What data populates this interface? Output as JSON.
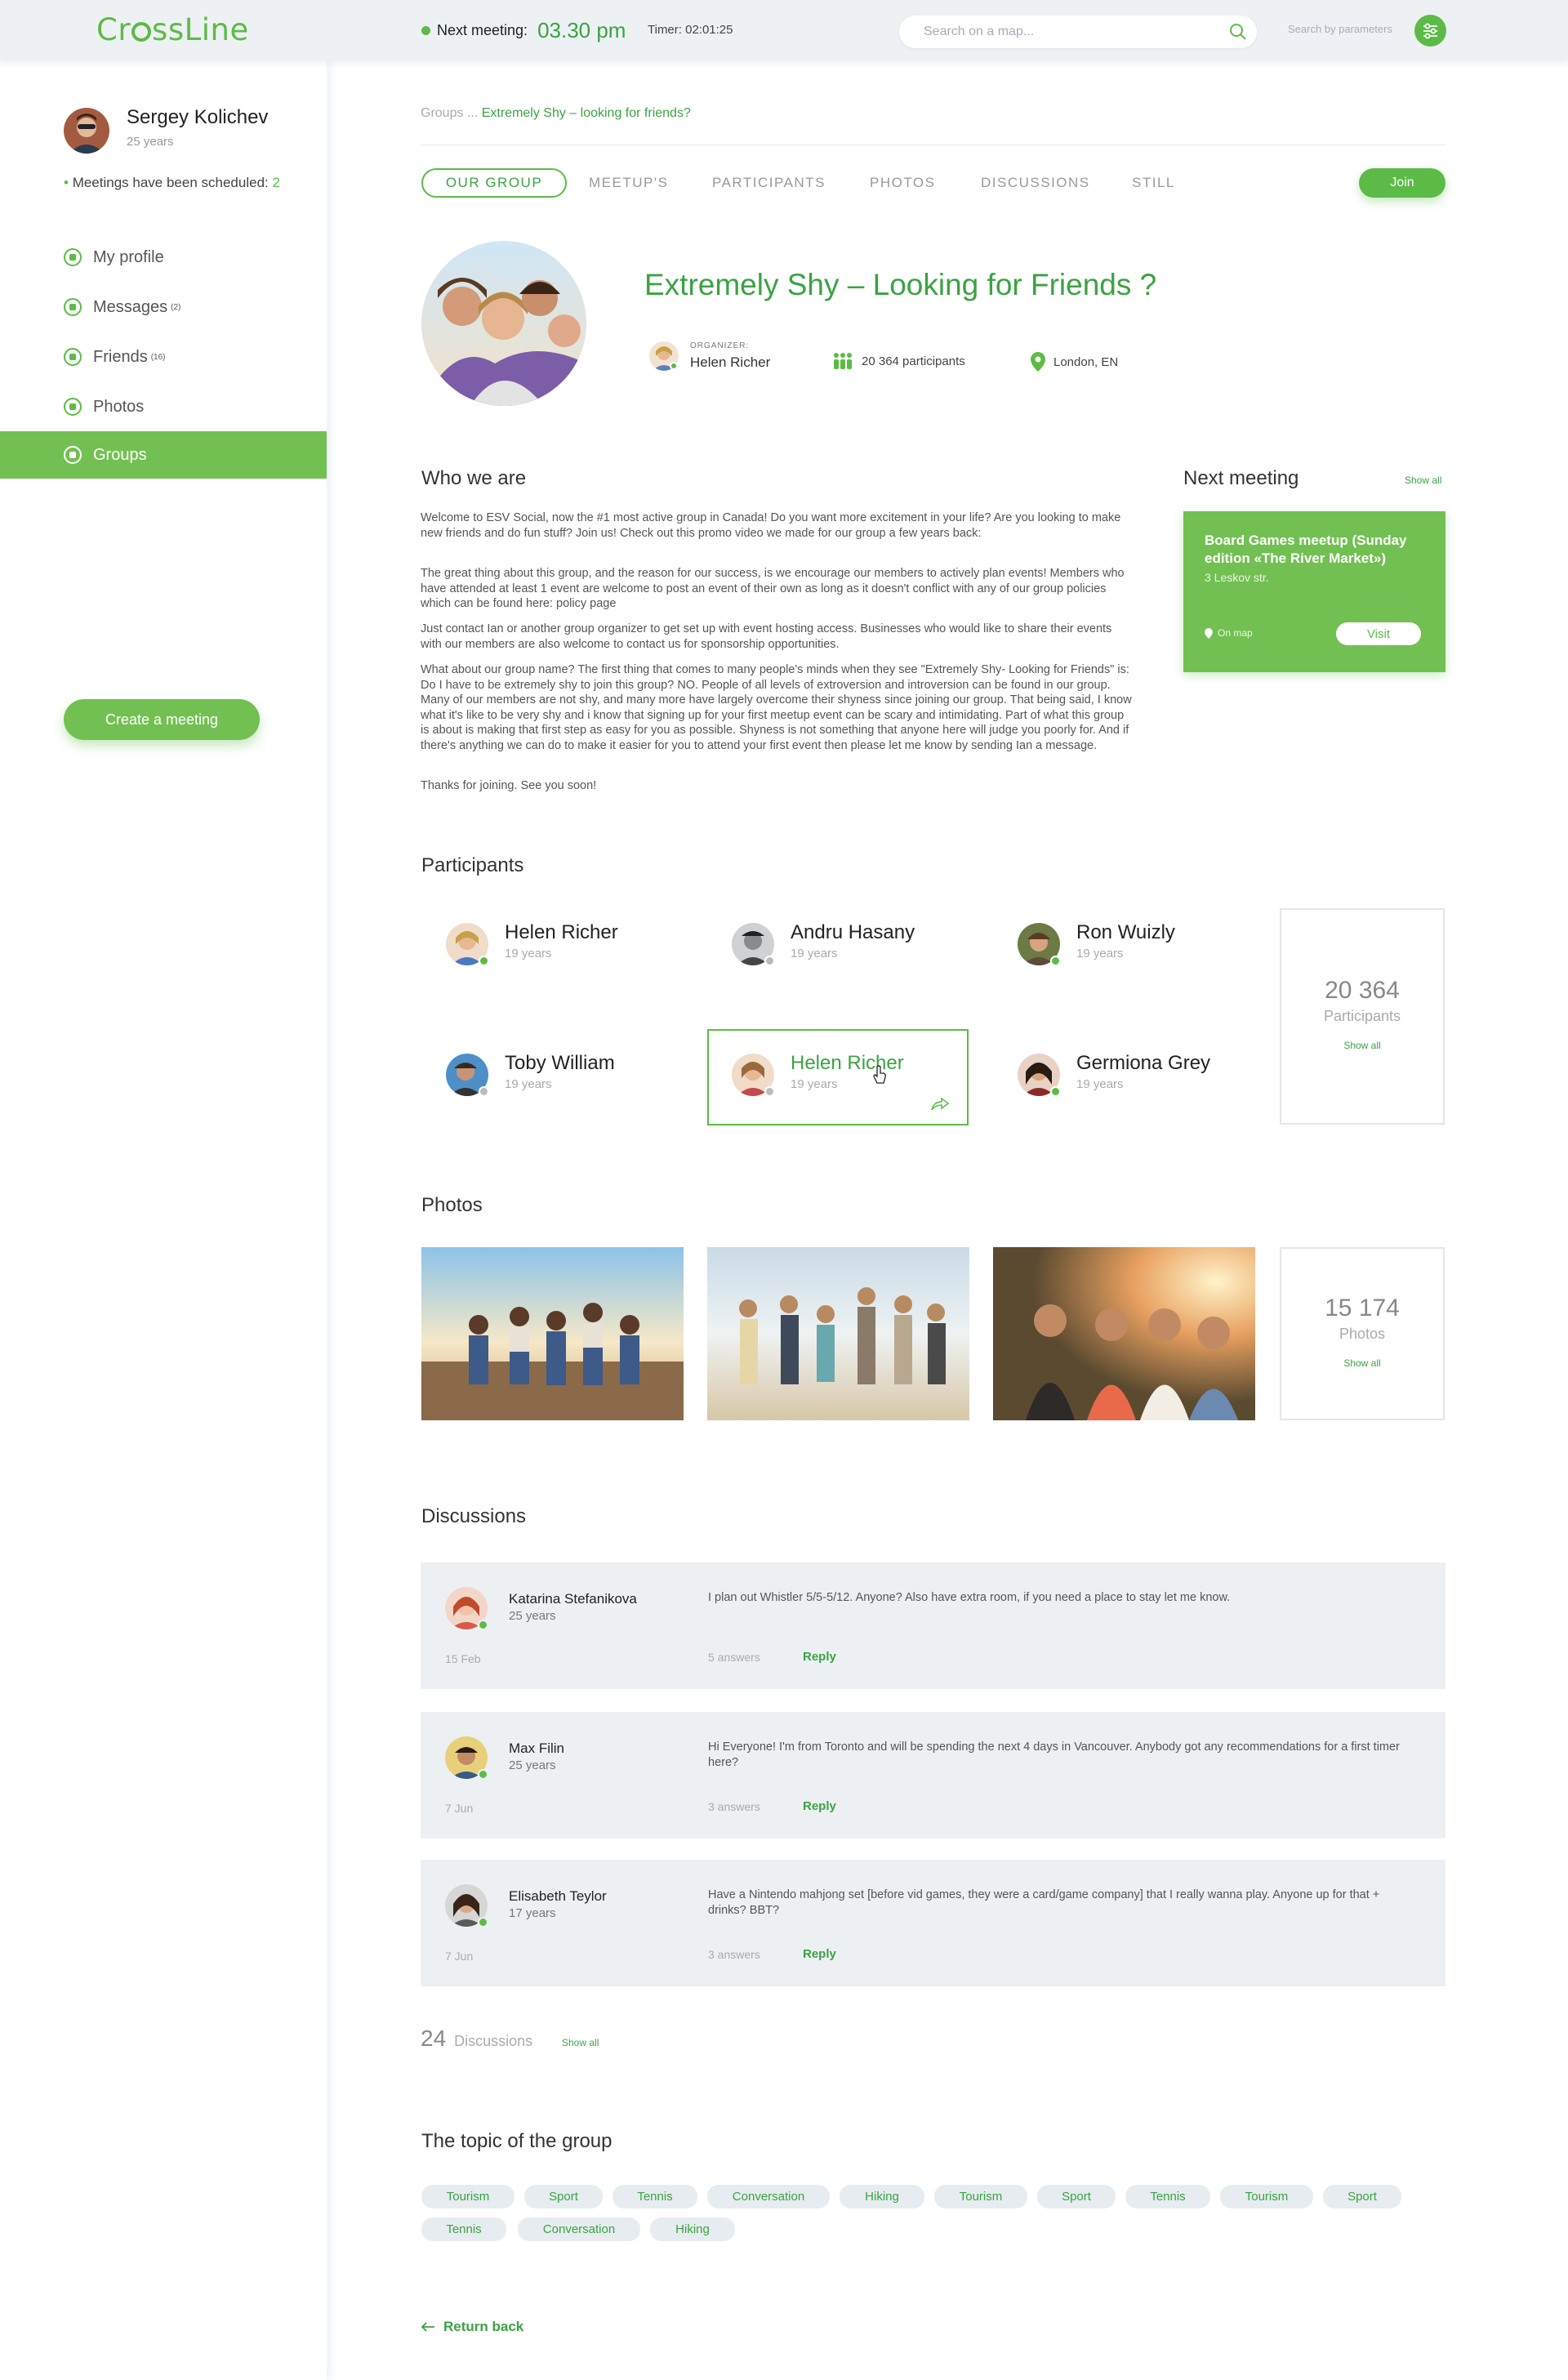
{
  "header": {
    "logo": "CrossLine",
    "next_meeting_label": "Next meeting:",
    "next_meeting_time": "03.30 pm",
    "timer": "Timer: 02:01:25",
    "search_placeholder": "Search on a map...",
    "search_by_params": "Search by parameters"
  },
  "user": {
    "name": "Sergey Kolichev",
    "age": "25 years",
    "meetings_label": "Meetings have been scheduled:",
    "meetings_count": "2"
  },
  "sidebar": {
    "items": [
      {
        "label": "My profile",
        "badge": ""
      },
      {
        "label": "Messages",
        "badge": "(2)"
      },
      {
        "label": "Friends",
        "badge": "(16)"
      },
      {
        "label": "Photos",
        "badge": ""
      },
      {
        "label": "Groups",
        "badge": ""
      }
    ],
    "create_button": "Create a meeting"
  },
  "breadcrumb": {
    "parent": "Groups",
    "sep": "...",
    "current": "Extremely Shy – looking for friends?"
  },
  "tabs": [
    "OUR GROUP",
    "MEETUP'S",
    "PARTICIPANTS",
    "PHOTOS",
    "DISCUSSIONS",
    "STILL"
  ],
  "join_label": "Join",
  "group": {
    "title": "Extremely Shy – Looking for Friends ?",
    "organizer_label": "ORGANIZER:",
    "organizer_name": "Helen Richer",
    "participants": "20 364 participants",
    "location": "London, EN"
  },
  "about": {
    "heading": "Who we are",
    "paragraphs": [
      "Welcome to ESV Social, now the #1 most active group in Canada! Do you want more excitement in your life? Are you looking to make new friends and do fun stuff? Join us! Check out this promo video we made for our group a few years back:",
      "The great thing about this group, and the reason for our success, is we encourage our members to actively plan events! Members who have attended at least 1 event are welcome to post an event of their own as long as it doesn't conflict with any of our group policies which can be found here: policy page",
      "Just contact Ian or another group organizer to get set up with event hosting access. Businesses who would like to share their events with our members are also welcome to contact us for sponsorship opportunities.",
      "What about our group name? The first thing that comes to many people's minds when they see \"Extremely Shy- Looking for Friends\" is: Do I have to be extremely shy to join this group? NO. People of all levels of extroversion and introversion can be found in our group. Many of our members are not shy, and many more have largely overcome their shyness since joining our group. That being said, I know what it's like to be very shy and i know that signing up for your first meetup event can be scary and intimidating. Part of what this group is about is making that first step as easy for you as possible. Shyness is not something that anyone here will judge you poorly for. And if there's anything we can do to make it easier for you to attend your first event then please let me know by sending Ian a message.",
      "Thanks for joining. See you soon!"
    ]
  },
  "next_meeting": {
    "heading": "Next meeting",
    "show_all": "Show all",
    "title": "Board Games meetup (Sunday edition «The River Market»)",
    "address": "3 Leskov str.",
    "on_map": "On map",
    "visit": "Visit"
  },
  "participants": {
    "heading": "Participants",
    "list": [
      {
        "name": "Helen Richer",
        "age": "19 years",
        "online": true
      },
      {
        "name": "Andru Hasany",
        "age": "19 years",
        "online": false
      },
      {
        "name": "Ron Wuizly",
        "age": "19 years",
        "online": true
      },
      {
        "name": "Toby William",
        "age": "19 years",
        "online": false
      },
      {
        "name": "Helen Richer",
        "age": "19 years",
        "online": false
      },
      {
        "name": "Germiona Grey",
        "age": "19 years",
        "online": true
      }
    ],
    "total": "20 364",
    "total_label": "Participants",
    "show_all": "Show all"
  },
  "photos": {
    "heading": "Photos",
    "total": "15 174",
    "total_label": "Photos",
    "show_all": "Show all"
  },
  "discussions": {
    "heading": "Discussions",
    "items": [
      {
        "name": "Katarina Stefanikova",
        "age": "25 years",
        "date": "15 Feb",
        "text": "I plan out Whistler 5/5-5/12. Anyone? Also have extra room, if you need a place to stay let me know.",
        "answers": "5 answers",
        "reply": "Reply"
      },
      {
        "name": "Max Filin",
        "age": "25 years",
        "date": "7 Jun",
        "text": "Hi Everyone! I'm from Toronto and will be spending the next 4 days in Vancouver. Anybody got any recommendations for a first timer here?",
        "answers": "3 answers",
        "reply": "Reply"
      },
      {
        "name": "Elisabeth Teylor",
        "age": "17 years",
        "date": "7 Jun",
        "text": "Have a Nintendo mahjong set [before vid games, they were a card/game company] that I really wanna play. Anyone up for that + drinks? BBT?",
        "answers": "3 answers",
        "reply": "Reply"
      }
    ],
    "count": "24",
    "count_label": "Discussions",
    "show_all": "Show all"
  },
  "topics": {
    "heading": "The topic of the group",
    "tags": [
      "Tourism",
      "Sport",
      "Tennis",
      "Conversation",
      "Hiking",
      "Tourism",
      "Sport",
      "Tennis",
      "Tourism",
      "Sport",
      "Tennis",
      "Conversation",
      "Hiking"
    ]
  },
  "return_back": "Return back",
  "colors": {
    "accent": "#5cbb46",
    "accent_dark": "#3aa343",
    "card_bg": "#72c052",
    "panel_bg": "#edf0f3"
  }
}
